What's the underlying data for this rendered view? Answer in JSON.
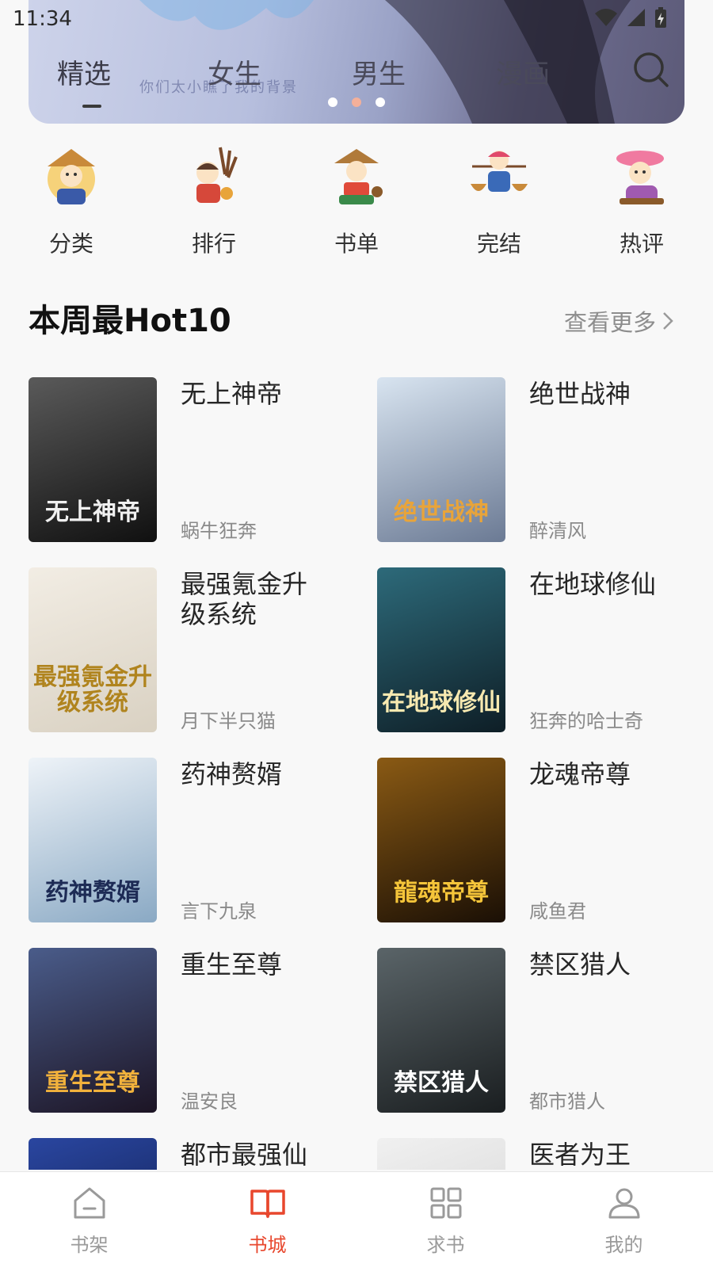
{
  "status_bar": {
    "time": "11:34",
    "icons": [
      "wifi-icon",
      "signal-icon",
      "battery-charging-icon"
    ]
  },
  "banner": {
    "subtitle": "你们太小瞧了我的背景",
    "active_dot": 1,
    "dot_count": 3
  },
  "top_tabs": [
    {
      "label": "精选",
      "active": true
    },
    {
      "label": "女生",
      "active": false
    },
    {
      "label": "男生",
      "active": false
    },
    {
      "label": "漫画",
      "active": false
    }
  ],
  "quick_entries": [
    {
      "label": "分类",
      "icon": "category-mascot-icon"
    },
    {
      "label": "排行",
      "icon": "rank-mascot-icon"
    },
    {
      "label": "书单",
      "icon": "booklist-mascot-icon"
    },
    {
      "label": "完结",
      "icon": "finished-mascot-icon"
    },
    {
      "label": "热评",
      "icon": "hot-review-mascot-icon"
    }
  ],
  "section": {
    "title": "本周最Hot10",
    "more_label": "查看更多"
  },
  "books": [
    {
      "title": "无上神帝",
      "author": "蜗牛狂奔",
      "cover_text": "无上神帝",
      "cover_colors": [
        "#5a5a5a",
        "#101010"
      ],
      "cover_text_color": "#f0f0f0"
    },
    {
      "title": "绝世战神",
      "author": "醉清风",
      "cover_text": "绝世战神",
      "cover_colors": [
        "#d8e4f0",
        "#6b7a94"
      ],
      "cover_text_color": "#e8a43a"
    },
    {
      "title": "最强氪金升级系统",
      "author": "月下半只猫",
      "cover_text": "最强氪金升级系统",
      "cover_colors": [
        "#f2ede4",
        "#d9d1c2"
      ],
      "cover_text_color": "#b0841e"
    },
    {
      "title": "在地球修仙",
      "author": "狂奔的哈士奇",
      "cover_text": "在地球修仙",
      "cover_colors": [
        "#2d6a7a",
        "#0e1e26"
      ],
      "cover_text_color": "#f7e9b0"
    },
    {
      "title": "药神赘婿",
      "author": "言下九泉",
      "cover_text": "药神赘婿",
      "cover_colors": [
        "#eef3f8",
        "#8aa9c4"
      ],
      "cover_text_color": "#1d2b55"
    },
    {
      "title": "龙魂帝尊",
      "author": "咸鱼君",
      "cover_text": "龍魂帝尊",
      "cover_colors": [
        "#8a5a14",
        "#1a0f05"
      ],
      "cover_text_color": "#f5c53a"
    },
    {
      "title": "重生至尊",
      "author": "温安良",
      "cover_text": "重生至尊",
      "cover_colors": [
        "#4a5c8a",
        "#1c1424"
      ],
      "cover_text_color": "#f2b23c"
    },
    {
      "title": "禁区猎人",
      "author": "都市猎人",
      "cover_text": "禁区猎人",
      "cover_colors": [
        "#5a6468",
        "#1a1e20"
      ],
      "cover_text_color": "#ffffff"
    },
    {
      "title": "都市最强仙",
      "author": "",
      "cover_text": "",
      "cover_colors": [
        "#2a46a0",
        "#0b1740"
      ],
      "cover_text_color": "#ffffff"
    },
    {
      "title": "医者为王",
      "author": "",
      "cover_text": "",
      "cover_colors": [
        "#f0f0f0",
        "#cfcfcf"
      ],
      "cover_text_color": "#333333"
    }
  ],
  "bottom_nav": [
    {
      "label": "书架",
      "icon": "bookshelf-icon",
      "active": false
    },
    {
      "label": "书城",
      "icon": "open-book-icon",
      "active": true
    },
    {
      "label": "求书",
      "icon": "grid-icon",
      "active": false
    },
    {
      "label": "我的",
      "icon": "user-icon",
      "active": false
    }
  ],
  "colors": {
    "accent": "#e8472d",
    "inactive": "#9a9a9a",
    "dot_active": "#f4b09a"
  }
}
